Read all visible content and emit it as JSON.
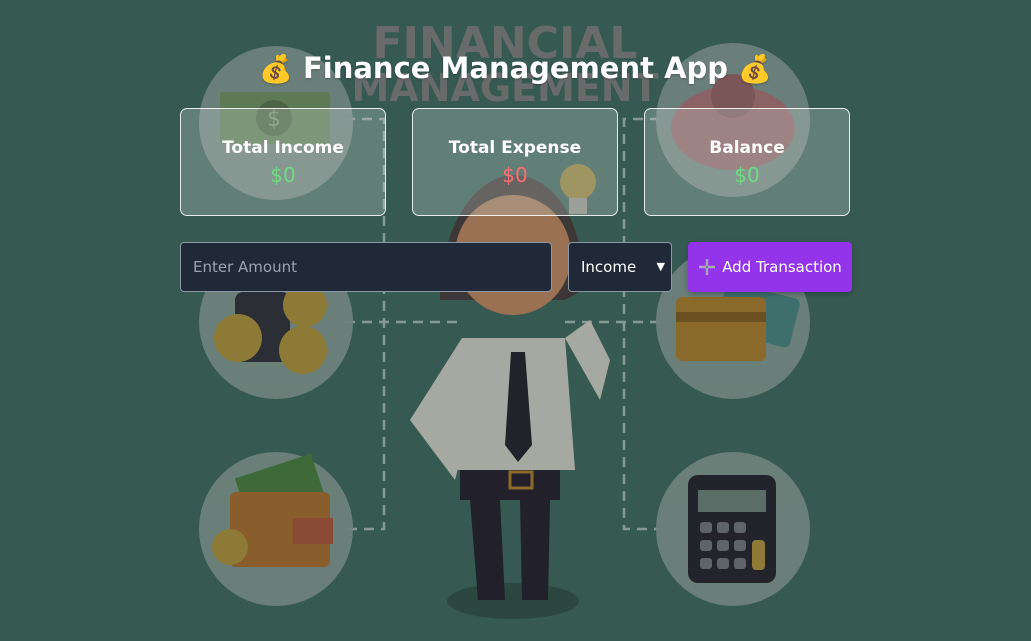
{
  "app": {
    "title": "Finance Management App",
    "title_icon": "money-bag-icon",
    "coin_glyph": "💰"
  },
  "background": {
    "headline_line1": "FINANCIAL",
    "headline_line2": "MANAGEMENT"
  },
  "summary": [
    {
      "label": "Total Income",
      "value": "$0",
      "color": "#6fdc83"
    },
    {
      "label": "Total Expense",
      "value": "$0",
      "color": "#f87171"
    },
    {
      "label": "Balance",
      "value": "$0",
      "color": "#6fdc83"
    }
  ],
  "form": {
    "amount_placeholder": "Enter Amount",
    "amount_value": "",
    "type_selected": "Income",
    "add_label": "Add Transaction",
    "add_icon": "plus-icon"
  },
  "colors": {
    "background": "#365a52",
    "accent": "#9333ea",
    "input_bg": "#1f2937"
  }
}
